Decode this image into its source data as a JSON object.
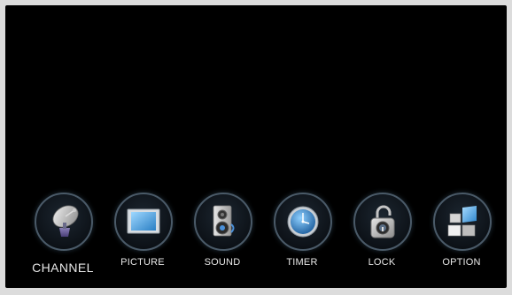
{
  "menu": {
    "items": [
      {
        "id": "channel",
        "label": "CHANNEL",
        "icon": "satellite-dish-icon",
        "selected": true
      },
      {
        "id": "picture",
        "label": "PICTURE",
        "icon": "picture-screen-icon",
        "selected": false
      },
      {
        "id": "sound",
        "label": "SOUND",
        "icon": "speaker-icon",
        "selected": false
      },
      {
        "id": "timer",
        "label": "TIMER",
        "icon": "clock-icon",
        "selected": false
      },
      {
        "id": "lock",
        "label": "LOCK",
        "icon": "padlock-icon",
        "selected": false
      },
      {
        "id": "option",
        "label": "OPTION",
        "icon": "option-blocks-icon",
        "selected": false
      }
    ]
  },
  "colors": {
    "background": "#000000",
    "ring": "#4a5a68",
    "label": "#e8e8e8"
  }
}
